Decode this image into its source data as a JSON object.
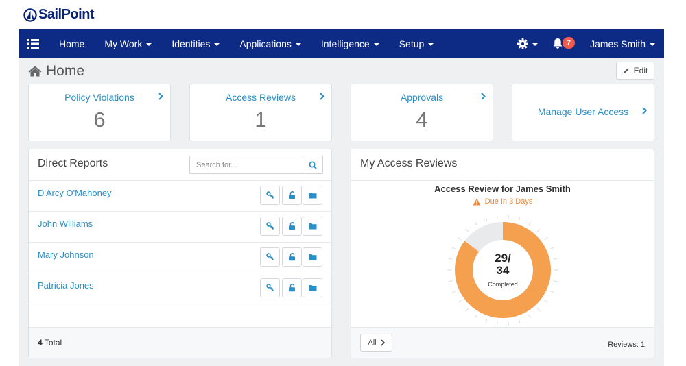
{
  "brand": {
    "name": "SailPoint"
  },
  "nav": {
    "items": [
      {
        "label": "Home",
        "has_caret": false
      },
      {
        "label": "My Work",
        "has_caret": true
      },
      {
        "label": "Identities",
        "has_caret": true
      },
      {
        "label": "Applications",
        "has_caret": true
      },
      {
        "label": "Intelligence",
        "has_caret": true
      },
      {
        "label": "Setup",
        "has_caret": true
      }
    ],
    "notifications_count": "7",
    "user_name": "James Smith",
    "icons": [
      "list-menu-icon",
      "gear-icon",
      "bell-icon"
    ]
  },
  "page": {
    "title": "Home",
    "edit_label": "Edit"
  },
  "cards": [
    {
      "title": "Policy Violations",
      "count": "6"
    },
    {
      "title": "Access Reviews",
      "count": "1"
    },
    {
      "title": "Approvals",
      "count": "4"
    },
    {
      "title": "Manage User Access",
      "count": ""
    }
  ],
  "direct_reports": {
    "title": "Direct Reports",
    "search_placeholder": "Search for...",
    "people": [
      {
        "name": "D'Arcy O'Mahoney"
      },
      {
        "name": "John Williams"
      },
      {
        "name": "Mary Johnson"
      },
      {
        "name": "Patricia Jones"
      }
    ],
    "row_actions": [
      "key-icon",
      "unlock-icon",
      "folder-icon"
    ],
    "total_count": "4",
    "total_label": "Total"
  },
  "access_reviews": {
    "title": "My Access Reviews",
    "review_name": "Access Review for James Smith",
    "due_text": "Due In 3 Days",
    "completed": 29,
    "total": 34,
    "completed_top": "29/",
    "completed_bottom": "34",
    "completed_label": "Completed",
    "all_label": "All",
    "reviews_label": "Reviews: 1"
  },
  "colors": {
    "brand_blue": "#0d2a85",
    "link_blue": "#2a8ec7",
    "donut_orange": "#f5a04f",
    "donut_remaining": "#e9eaeb",
    "warning_orange": "#f0893a",
    "badge_red": "#ef5b4c"
  }
}
